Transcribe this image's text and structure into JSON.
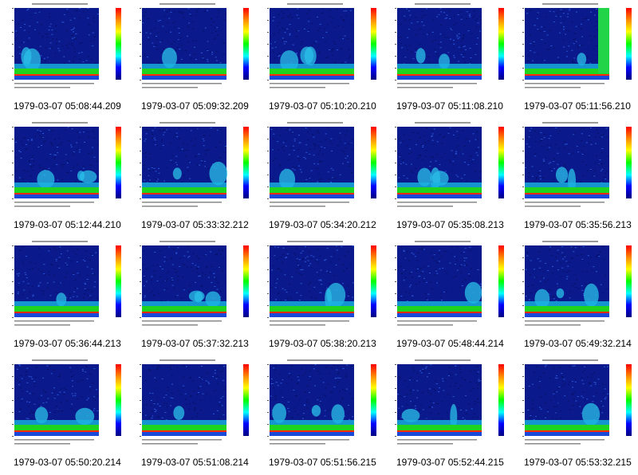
{
  "gallery": {
    "items": [
      {
        "caption": "1979-03-07 05:08:44.209"
      },
      {
        "caption": "1979-03-07 05:09:32.209"
      },
      {
        "caption": "1979-03-07 05:10:20.210"
      },
      {
        "caption": "1979-03-07 05:11:08.210"
      },
      {
        "caption": "1979-03-07 05:11:56.210"
      },
      {
        "caption": "1979-03-07 05:12:44.210"
      },
      {
        "caption": "1979-03-07 05:33:32.212"
      },
      {
        "caption": "1979-03-07 05:34:20.212"
      },
      {
        "caption": "1979-03-07 05:35:08.213"
      },
      {
        "caption": "1979-03-07 05:35:56.213"
      },
      {
        "caption": "1979-03-07 05:36:44.213"
      },
      {
        "caption": "1979-03-07 05:37:32.213"
      },
      {
        "caption": "1979-03-07 05:38:20.213"
      },
      {
        "caption": "1979-03-07 05:48:44.214"
      },
      {
        "caption": "1979-03-07 05:49:32.214"
      },
      {
        "caption": "1979-03-07 05:50:20.214"
      },
      {
        "caption": "1979-03-07 05:51:08.214"
      },
      {
        "caption": "1979-03-07 05:51:56.215"
      },
      {
        "caption": "1979-03-07 05:52:44.215"
      },
      {
        "caption": "1979-03-07 05:53:32.215"
      }
    ]
  },
  "colors": {
    "spectrogram_background": "#0a1a8c",
    "noise_band_low": "#1fd41f",
    "noise_band_high": "#ff2a00",
    "colorbar": [
      "#ff0000",
      "#ff8c00",
      "#ffff00",
      "#00ff00",
      "#00ffff",
      "#0000ff",
      "#000080"
    ]
  }
}
